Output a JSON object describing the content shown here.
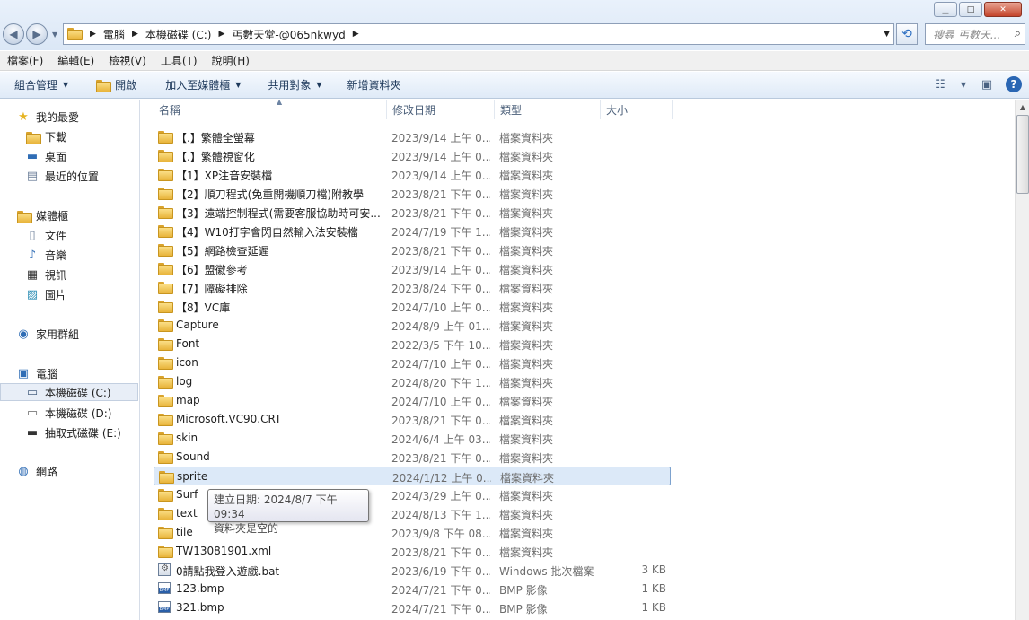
{
  "window": {
    "minimize": "▭",
    "maximize": "□",
    "close": "✕"
  },
  "address": {
    "crumbs": [
      "電腦",
      "本機磁碟 (C:)",
      "丐數天堂-@065nkwyd"
    ]
  },
  "search": {
    "placeholder": "搜尋 丐數天..."
  },
  "menu": [
    "檔案(F)",
    "編輯(E)",
    "檢視(V)",
    "工具(T)",
    "說明(H)"
  ],
  "commands": {
    "organize": "組合管理",
    "open": "開啟",
    "add_to_library": "加入至媒體櫃",
    "share_with": "共用對象",
    "new_folder": "新增資料夾"
  },
  "sidebar": {
    "favorites": "我的最愛",
    "downloads": "下載",
    "desktop": "桌面",
    "recent": "最近的位置",
    "libraries": "媒體櫃",
    "documents": "文件",
    "music": "音樂",
    "videos": "視訊",
    "pictures": "圖片",
    "homegroup": "家用群組",
    "computer": "電腦",
    "drive_c": "本機磁碟 (C:)",
    "drive_d": "本機磁碟 (D:)",
    "drive_e": "抽取式磁碟 (E:)",
    "network": "網路"
  },
  "columns": {
    "name": "名稱",
    "date": "修改日期",
    "type": "類型",
    "size": "大小"
  },
  "files": [
    {
      "name": "【.】繁體全螢幕",
      "date": "2023/9/14 上午 0...",
      "type": "檔案資料夾",
      "size": "",
      "icon": "folder"
    },
    {
      "name": "【.】繁體視窗化",
      "date": "2023/9/14 上午 0...",
      "type": "檔案資料夾",
      "size": "",
      "icon": "folder"
    },
    {
      "name": "【1】XP注音安裝檔",
      "date": "2023/9/14 上午 0...",
      "type": "檔案資料夾",
      "size": "",
      "icon": "folder"
    },
    {
      "name": "【2】順刀程式(免重開機順刀檔)附教學",
      "date": "2023/8/21 下午 0...",
      "type": "檔案資料夾",
      "size": "",
      "icon": "folder"
    },
    {
      "name": "【3】遠端控制程式(需要客服協助時可安...",
      "date": "2023/8/21 下午 0...",
      "type": "檔案資料夾",
      "size": "",
      "icon": "folder"
    },
    {
      "name": "【4】W10打字會閃自然輸入法安裝檔",
      "date": "2024/7/19 下午 1...",
      "type": "檔案資料夾",
      "size": "",
      "icon": "folder"
    },
    {
      "name": "【5】網路檢查延遲",
      "date": "2023/8/21 下午 0...",
      "type": "檔案資料夾",
      "size": "",
      "icon": "folder"
    },
    {
      "name": "【6】盟徽參考",
      "date": "2023/9/14 上午 0...",
      "type": "檔案資料夾",
      "size": "",
      "icon": "folder"
    },
    {
      "name": "【7】障礙排除",
      "date": "2023/8/24 下午 0...",
      "type": "檔案資料夾",
      "size": "",
      "icon": "folder"
    },
    {
      "name": "【8】VC庫",
      "date": "2024/7/10 上午 0...",
      "type": "檔案資料夾",
      "size": "",
      "icon": "folder"
    },
    {
      "name": "Capture",
      "date": "2024/8/9 上午 01...",
      "type": "檔案資料夾",
      "size": "",
      "icon": "folder"
    },
    {
      "name": "Font",
      "date": "2022/3/5 下午 10...",
      "type": "檔案資料夾",
      "size": "",
      "icon": "folder"
    },
    {
      "name": "icon",
      "date": "2024/7/10 上午 0...",
      "type": "檔案資料夾",
      "size": "",
      "icon": "folder"
    },
    {
      "name": "log",
      "date": "2024/8/20 下午 1...",
      "type": "檔案資料夾",
      "size": "",
      "icon": "folder"
    },
    {
      "name": "map",
      "date": "2024/7/10 上午 0...",
      "type": "檔案資料夾",
      "size": "",
      "icon": "folder"
    },
    {
      "name": "Microsoft.VC90.CRT",
      "date": "2023/8/21 下午 0...",
      "type": "檔案資料夾",
      "size": "",
      "icon": "folder"
    },
    {
      "name": "skin",
      "date": "2024/6/4 上午 03...",
      "type": "檔案資料夾",
      "size": "",
      "icon": "folder"
    },
    {
      "name": "Sound",
      "date": "2023/8/21 下午 0...",
      "type": "檔案資料夾",
      "size": "",
      "icon": "folder"
    },
    {
      "name": "sprite",
      "date": "2024/1/12 上午 0...",
      "type": "檔案資料夾",
      "size": "",
      "icon": "folder",
      "selected": true
    },
    {
      "name": "Surf",
      "date": "2024/3/29 上午 0...",
      "type": "檔案資料夾",
      "size": "",
      "icon": "folder"
    },
    {
      "name": "text",
      "date": "2024/8/13 下午 1...",
      "type": "檔案資料夾",
      "size": "",
      "icon": "folder"
    },
    {
      "name": "tile",
      "date": "2023/9/8 下午 08...",
      "type": "檔案資料夾",
      "size": "",
      "icon": "folder"
    },
    {
      "name": "TW13081901.xml",
      "date": "2023/8/21 下午 0...",
      "type": "檔案資料夾",
      "size": "",
      "icon": "folder"
    },
    {
      "name": "0請點我登入遊戲.bat",
      "date": "2023/6/19 下午 0...",
      "type": "Windows 批次檔案",
      "size": "3 KB",
      "icon": "bat"
    },
    {
      "name": "123.bmp",
      "date": "2024/7/21 下午 0...",
      "type": "BMP 影像",
      "size": "1 KB",
      "icon": "bmp"
    },
    {
      "name": "321.bmp",
      "date": "2024/7/21 下午 0...",
      "type": "BMP 影像",
      "size": "1 KB",
      "icon": "bmp"
    }
  ],
  "tooltip": {
    "line1": "建立日期: 2024/8/7 下午 09:34",
    "line2": "資料夾是空的"
  },
  "icons": {
    "back": "back-arrow-icon",
    "forward": "forward-arrow-icon",
    "refresh": "refresh-icon",
    "search": "search-icon",
    "help": "help-icon"
  },
  "colors": {
    "selection": "#dce9f8",
    "selection_border": "#7da2ce",
    "command_text": "#1e395b"
  }
}
